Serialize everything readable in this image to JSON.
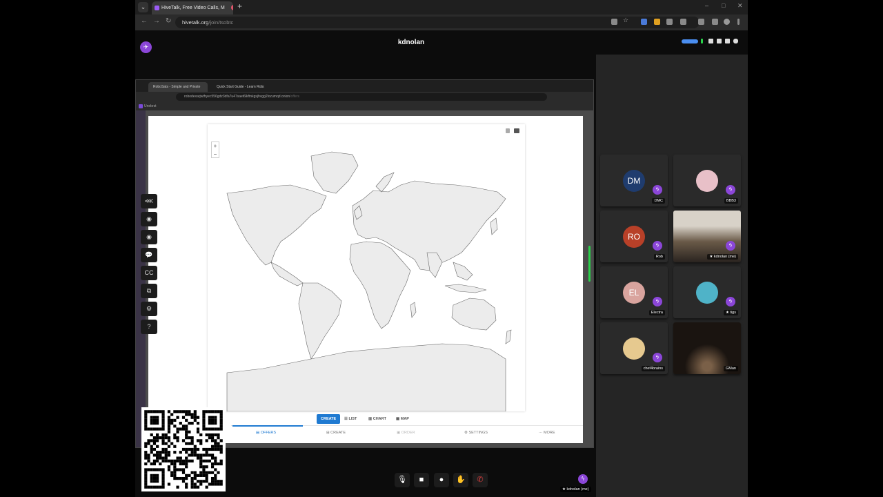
{
  "browser": {
    "tab_title": "HiveTalk, Free Video Calls, M",
    "url_domain": "hivetalk.org",
    "url_path": "/join/tsobtc",
    "tab_close": "×",
    "new_tab": "+",
    "window_controls": [
      "–",
      "□",
      "✕"
    ]
  },
  "room": {
    "title": "kdnolan",
    "logo_icon": "bee-logo-icon"
  },
  "shared_screen": {
    "tabs": [
      "RoboSats - Simple and Private",
      "Quick Start Guide - Learn Robo"
    ],
    "url_domain": "robodexarjwtfryec556gdz3dfa7u47saet6lkftnkgsjhvgg2lozumqd.onion",
    "url_path": "/offers",
    "bookmark": "Unebrst",
    "map_zoom": [
      "+",
      "−"
    ],
    "view_buttons": {
      "create": "CREATE",
      "list": "LIST",
      "chart": "CHART",
      "map": "MAP"
    },
    "bottom_nav": {
      "offers": "OFFERS",
      "create": "CREATE",
      "order": "ORDER",
      "settings": "SETTINGS",
      "more": "MORE"
    }
  },
  "left_toolbar": [
    "share-icon",
    "circle-icon",
    "circle-icon",
    "chat-icon",
    "captions-icon",
    "screen-share-icon",
    "settings-icon",
    "help-icon"
  ],
  "left_toolbar_glyphs": [
    "⋘",
    "◉",
    "◉",
    "💬",
    "CC",
    "⧉",
    "⚙",
    "?"
  ],
  "participants": [
    {
      "initials": "DM",
      "name": "DMC",
      "color": "#1f3c6e"
    },
    {
      "initials": "",
      "name": "BBB3",
      "color": "#e8c0c8"
    },
    {
      "initials": "RO",
      "name": "Rob",
      "color": "#b84028"
    },
    {
      "initials": "",
      "name": "★ kdnolan (me)",
      "color": "#c9a880"
    },
    {
      "initials": "EL",
      "name": "Electra",
      "color": "#d9a49e"
    },
    {
      "initials": "",
      "name": "★ tigs",
      "color": "#4fb3c8"
    },
    {
      "initials": "",
      "name": "chef4brains",
      "color": "#e6c98f"
    },
    {
      "initials": "",
      "name": "GMan",
      "color": "#1a1410"
    }
  ],
  "controls": {
    "mic_icon": "🎙",
    "camera_icon": "■",
    "record_icon": "●",
    "hand_icon": "✋",
    "leave_icon": "✆"
  },
  "self_tile_name": "★ kdnolan (me)"
}
